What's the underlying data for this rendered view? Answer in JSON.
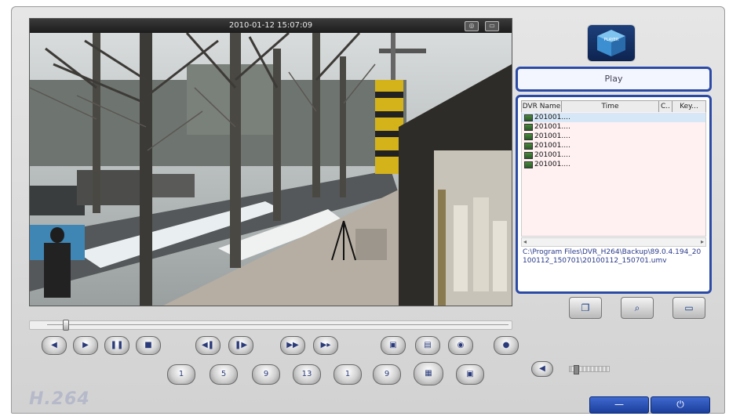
{
  "video": {
    "timestamp": "2010-01-12 15:07:09",
    "titlebar_icons": [
      "camera-icon",
      "monitor-icon"
    ]
  },
  "logo": {
    "text": "PLAYER",
    "icon": "player-cube-icon"
  },
  "status": {
    "label": "Play"
  },
  "file_list": {
    "columns": [
      "DVR Name",
      "Time",
      "C..",
      "Key..."
    ],
    "rows": [
      {
        "name": "201001....",
        "selected": true
      },
      {
        "name": "201001...."
      },
      {
        "name": "201001...."
      },
      {
        "name": "201001...."
      },
      {
        "name": "201001...."
      },
      {
        "name": "201001...."
      }
    ],
    "path": "C:\\Program Files\\DVR_H264\\Backup\\89.0.4.194_20100112_150701\\20100112_150701.umv"
  },
  "side_buttons": [
    {
      "name": "open-folder-button",
      "glyph": "❐"
    },
    {
      "name": "search-button",
      "glyph": "⌕"
    },
    {
      "name": "print-button",
      "glyph": "▭"
    }
  ],
  "playback": {
    "position_fraction": 0.04
  },
  "row1_buttons": [
    {
      "name": "prev-button",
      "glyph": "◀"
    },
    {
      "name": "play-button",
      "glyph": "▶"
    },
    {
      "name": "pause-button",
      "glyph": "❚❚"
    },
    {
      "name": "stop-button",
      "glyph": "■"
    },
    {
      "name": "step-back-button",
      "glyph": "◀❚"
    },
    {
      "name": "step-forward-button",
      "glyph": "❚▶"
    },
    {
      "name": "fast-forward-button",
      "glyph": "▶▶"
    },
    {
      "name": "slow-button",
      "glyph": "▶▸"
    },
    {
      "name": "snapshot-button",
      "glyph": "▣"
    },
    {
      "name": "print-frame-button",
      "glyph": "▤"
    },
    {
      "name": "capture-button",
      "glyph": "◉"
    },
    {
      "name": "record-button",
      "glyph": "●"
    }
  ],
  "layout_buttons": [
    {
      "name": "layout-1-button",
      "label": "1"
    },
    {
      "name": "layout-5-button",
      "label": "5"
    },
    {
      "name": "layout-9-button",
      "label": "9"
    },
    {
      "name": "layout-13-button",
      "label": "13"
    },
    {
      "name": "layout-1b-button",
      "label": "1"
    },
    {
      "name": "layout-9b-button",
      "label": "9"
    },
    {
      "name": "layout-16-button",
      "label": "▦"
    },
    {
      "name": "layout-multi-button",
      "label": "▣"
    }
  ],
  "volume": {
    "level": 0.1
  },
  "brand": "H.264",
  "window_buttons": [
    {
      "name": "minimize-button",
      "glyph": "—"
    },
    {
      "name": "power-button",
      "glyph": "⏻"
    }
  ]
}
